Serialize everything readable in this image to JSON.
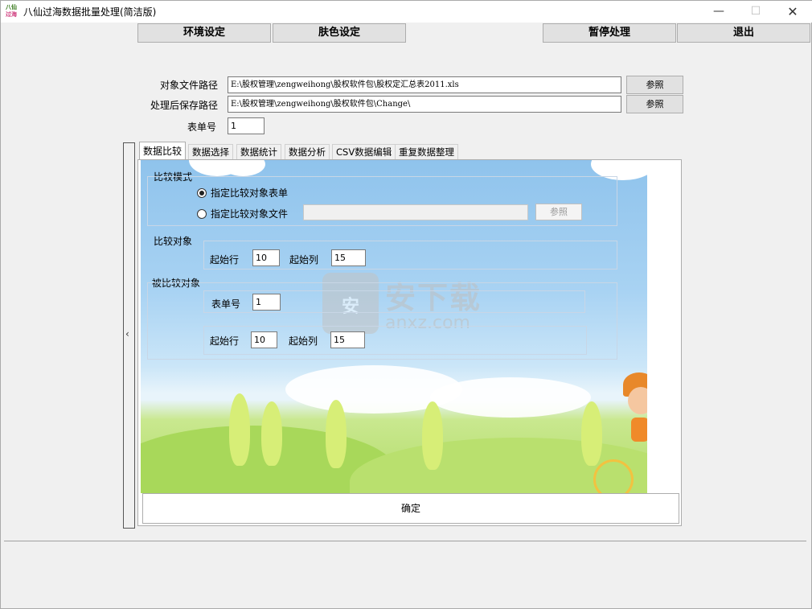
{
  "window": {
    "title": "八仙过海数据批量处理(简洁版)",
    "icon_top": "八仙",
    "icon_bottom": "过海",
    "controls": {
      "minimize": "—",
      "maximize": "☐",
      "close": "✕"
    }
  },
  "toolbar": {
    "env_settings": "环境设定",
    "skin_settings": "肤色设定",
    "pause": "暂停处理",
    "exit": "退出"
  },
  "paths": {
    "target_label": "对象文件路径",
    "target_value": "E:\\股权管理\\zengweihong\\股权软件包\\股权定汇总表2011.xls",
    "save_label": "处理后保存路径",
    "save_value": "E:\\股权管理\\zengweihong\\股权软件包\\Change\\",
    "browse_label": "参照",
    "sheet_label": "表单号",
    "sheet_value": "1"
  },
  "side_handle_glyph": "‹",
  "tabs": [
    {
      "label": "数据比较",
      "active": true
    },
    {
      "label": "数据选择",
      "active": false
    },
    {
      "label": "数据统计",
      "active": false
    },
    {
      "label": "数据分析",
      "active": false
    },
    {
      "label": "CSV数据编辑",
      "active": false
    },
    {
      "label": "重复数据整理",
      "active": false
    }
  ],
  "compare": {
    "mode_title": "比较模式",
    "opt_sheet": "指定比较对象表单",
    "opt_file": "指定比较对象文件",
    "selected": "opt_sheet",
    "file_value": "",
    "browse_label": "参照",
    "object_title": "比较对象",
    "start_row_label": "起始行",
    "start_row_value": "10",
    "start_col_label": "起始列",
    "start_col_value": "15",
    "compared_title": "被比较对象",
    "sheet_label": "表单号",
    "sheet_value": "1",
    "c_start_row_label": "起始行",
    "c_start_row_value": "10",
    "c_start_col_label": "起始列",
    "c_start_col_value": "15"
  },
  "watermark": {
    "text": "安下载",
    "sub": "anxz.com",
    "shield": "安"
  },
  "ok_label": "确定",
  "colors": {
    "sky": "#a9d3f3",
    "grass": "#b3dc6a"
  }
}
